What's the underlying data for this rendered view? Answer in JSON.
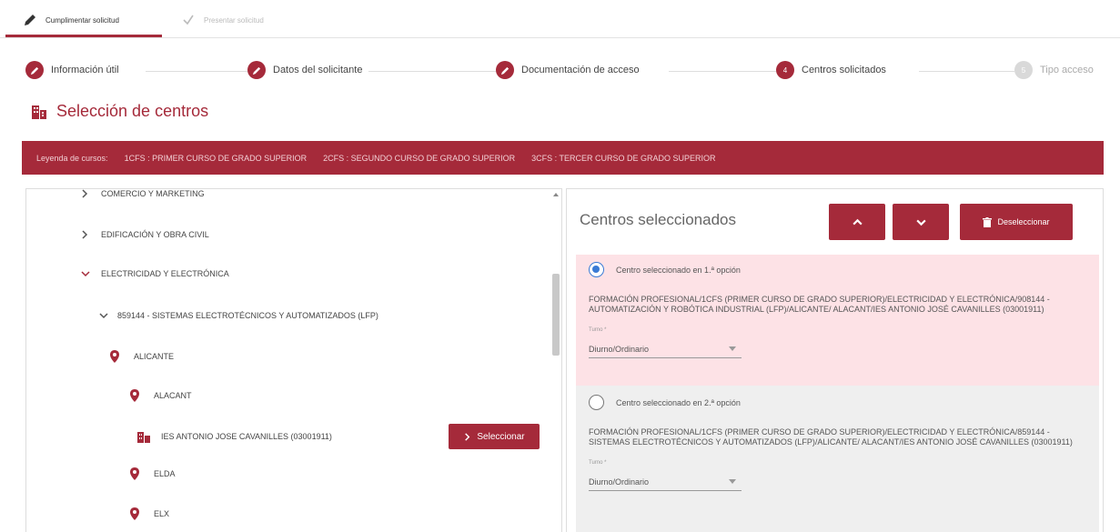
{
  "tabs": [
    {
      "label": "Cumplimentar solicitud",
      "active": true
    },
    {
      "label": "Presentar solicitud",
      "active": false
    }
  ],
  "stepper": {
    "steps": [
      {
        "label": "Información útil",
        "status": "done"
      },
      {
        "label": "Datos del solicitante",
        "status": "done"
      },
      {
        "label": "Documentación de acceso",
        "status": "done"
      },
      {
        "label": "Centros solicitados",
        "status": "current",
        "number": "4"
      },
      {
        "label": "Tipo acceso",
        "status": "pending",
        "number": "5"
      }
    ]
  },
  "section": {
    "title": "Selección de centros"
  },
  "legend": {
    "label": "Leyenda de cursos:",
    "items": [
      "1CFS : PRIMER CURSO DE GRADO SUPERIOR",
      "2CFS : SEGUNDO CURSO DE GRADO SUPERIOR",
      "3CFS : TERCER CURSO DE GRADO SUPERIOR"
    ]
  },
  "tree": {
    "items": [
      {
        "label": "COMERCIO Y MARKETING",
        "type": "family",
        "expanded": false
      },
      {
        "label": "EDIFICACIÓN Y OBRA CIVIL",
        "type": "family",
        "expanded": false
      },
      {
        "label": "ELECTRICIDAD Y ELECTRÓNICA",
        "type": "family",
        "expanded": true
      },
      {
        "label": "859144 - SISTEMAS ELECTROTÉCNICOS Y AUTOMATIZADOS (LFP)",
        "type": "cycle",
        "expanded": true
      },
      {
        "label": "ALICANTE",
        "type": "province"
      },
      {
        "label": "ALACANT",
        "type": "city"
      },
      {
        "label": "IES ANTONIO JOSE CAVANILLES (03001911)",
        "type": "center"
      },
      {
        "label": "ELDA",
        "type": "province"
      },
      {
        "label": "ELX",
        "type": "province"
      }
    ],
    "select_label": "Seleccionar"
  },
  "selected": {
    "title": "Centros seleccionados",
    "deselect_label": "Deseleccionar",
    "options": [
      {
        "label": "Centro seleccionado en 1.ª opción",
        "checked": true,
        "description": "FORMACIÓN PROFESIONAL/1CFS (PRIMER CURSO DE GRADO SUPERIOR)/ELECTRICIDAD Y ELECTRÓNICA/908144 - AUTOMATIZACIÓN Y ROBÓTICA INDUSTRIAL (LFP)/ALICANTE/ ALACANT/IES ANTONIO JOSÉ CAVANILLES (03001911)",
        "turno_label": "Turno *",
        "turno_value": "Diurno/Ordinario"
      },
      {
        "label": "Centro seleccionado en 2.ª opción",
        "checked": false,
        "description": "FORMACIÓN PROFESIONAL/1CFS (PRIMER CURSO DE GRADO SUPERIOR)/ELECTRICIDAD Y ELECTRÓNICA/859144 - SISTEMAS ELECTROTÉCNICOS Y AUTOMATIZADOS (LFP)/ALICANTE/ ALACANT/IES ANTONIO JOSÉ CAVANILLES (03001911)",
        "turno_label": "Turno *",
        "turno_value": "Diurno/Ordinario"
      }
    ]
  },
  "colors": {
    "accent": "#a52a3a",
    "option1_bg": "#fde2e6",
    "option2_bg": "#efefef",
    "radio": "#3a7bd5"
  }
}
